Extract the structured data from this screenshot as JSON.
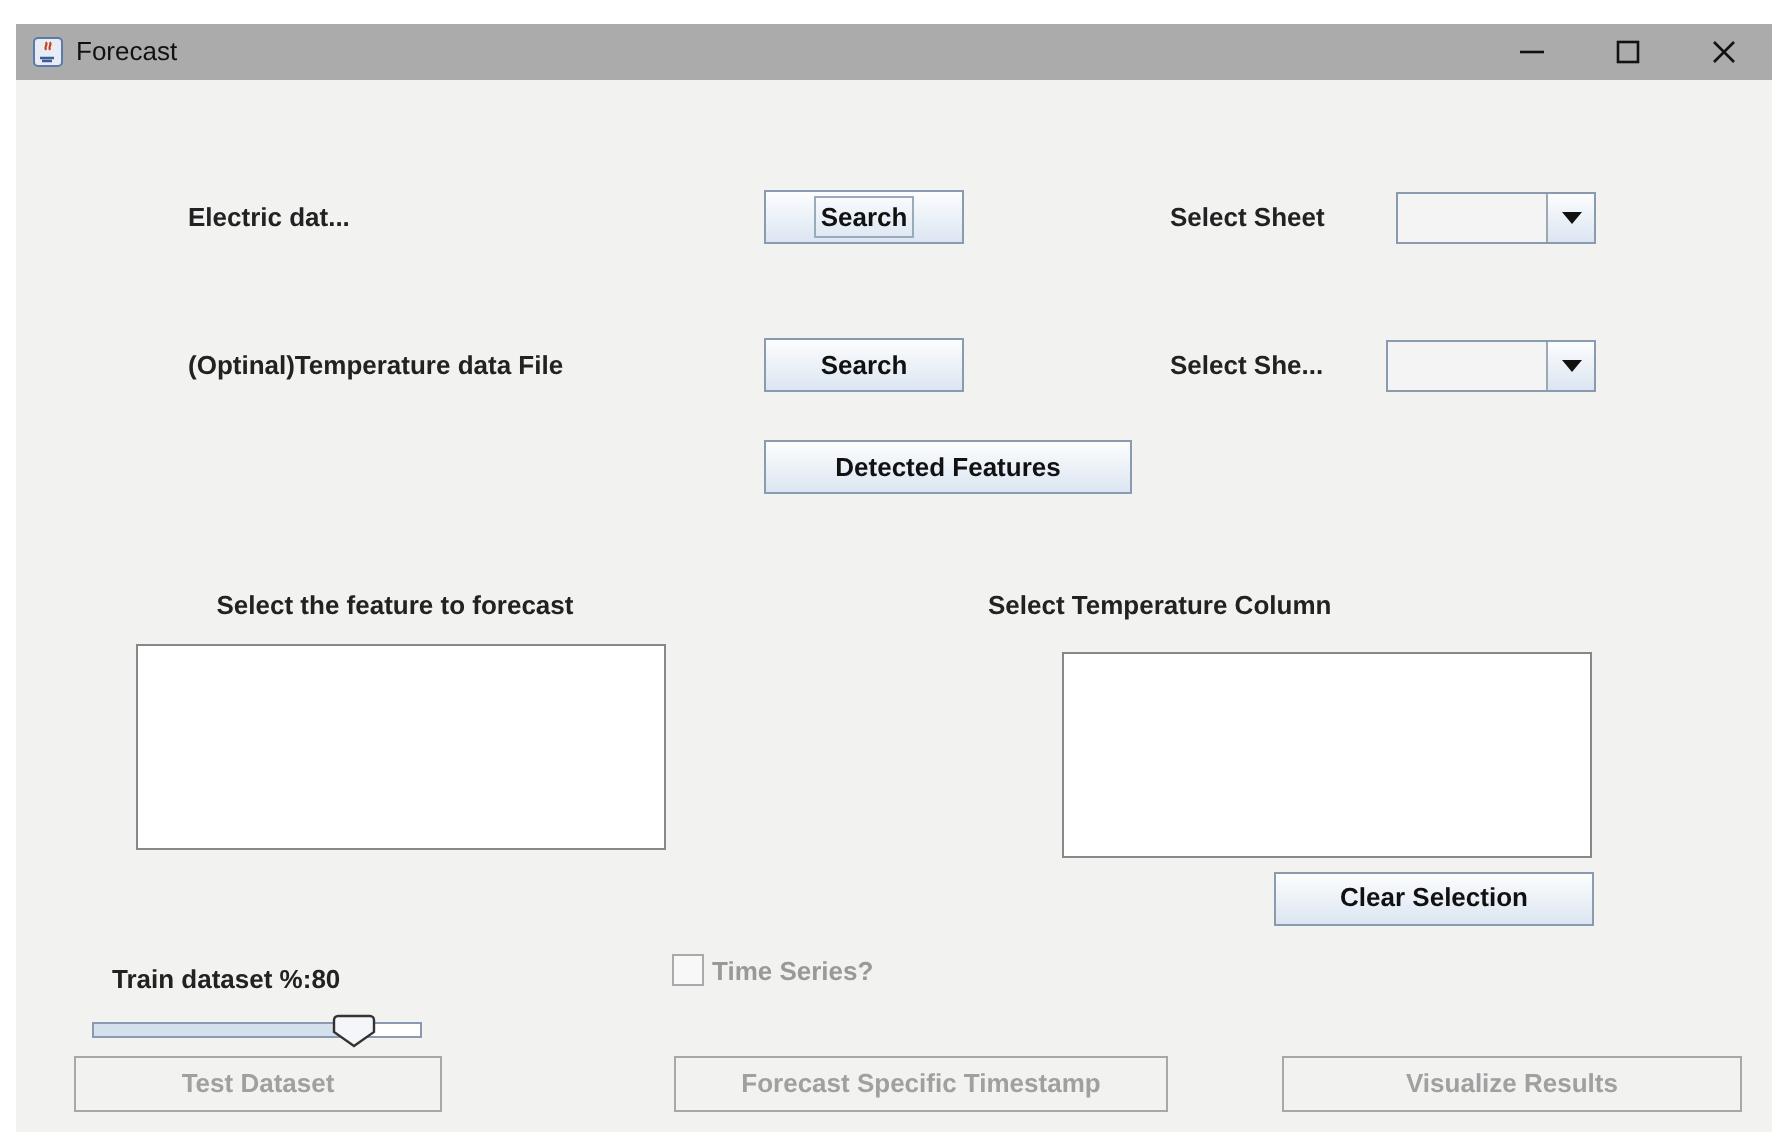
{
  "window": {
    "title": "Forecast"
  },
  "files": [
    {
      "label": "Electric dat...",
      "button": "Search",
      "focused": true,
      "sheet_label": "Select Sheet"
    },
    {
      "label": "(Optinal)Temperature data File",
      "button": "Search",
      "focused": false,
      "sheet_label": "Select She..."
    }
  ],
  "detect_button": "Detected Features",
  "feature_list": {
    "title": "Select the feature to forecast"
  },
  "temperature_list": {
    "title": "Select Temperature Column",
    "clear_button": "Clear Selection"
  },
  "train": {
    "label": "Train dataset %:80",
    "level": 0.8
  },
  "time_series": {
    "label": "Time Series?",
    "checked": false,
    "disabled": true
  },
  "actions": [
    {
      "label": "Test Dataset",
      "disabled": true
    },
    {
      "label": "Forecast Specific Timestamp",
      "disabled": true
    },
    {
      "label": "Visualize Results",
      "disabled": true
    }
  ]
}
